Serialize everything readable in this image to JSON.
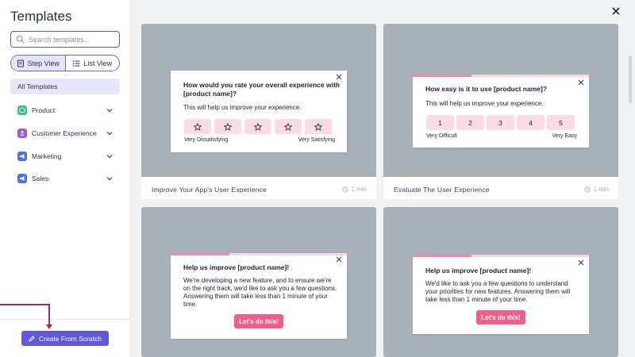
{
  "sidebar": {
    "title": "Templates",
    "search_placeholder": "Search templates..",
    "view_toggle": {
      "step_view": "Step View",
      "list_view": "List View"
    },
    "all_templates": "All Templates",
    "categories": [
      {
        "label": "Product",
        "icon": "cube-icon",
        "color": "#3dbf7f"
      },
      {
        "label": "Customer Experience",
        "icon": "users-icon",
        "color": "#a458d4"
      },
      {
        "label": "Marketing",
        "icon": "megaphone-icon",
        "color": "#4f72e3"
      },
      {
        "label": "Sales",
        "icon": "megaphone-icon",
        "color": "#4f72e3"
      }
    ],
    "create_button": "Create From Scratch"
  },
  "templates": [
    {
      "title": "Improve Your App's User Experience",
      "time": "1 min",
      "question": "How would you rate your overall experience with [product name]?",
      "subtitle": "This will help us improve your experience.",
      "scale_low": "Very Dissatisfying",
      "scale_high": "Very Satisfying"
    },
    {
      "title": "Evaluate The User Experience",
      "time": "1 min",
      "question": "How easy is it to use [product name]?",
      "subtitle": "This will help us improve your experience.",
      "options": [
        "1",
        "2",
        "3",
        "4",
        "5"
      ],
      "scale_low": "Very Difficult",
      "scale_high": "Very Easy"
    },
    {
      "title": "Help us improve [product name]!",
      "body": "We're developing a new feature, and to ensure we're on the right track, we'd like to ask you a few questions. Answering them will take less than 1 minute of your time.",
      "cta": "Let's do this!"
    },
    {
      "title": "Help us improve [product name]!",
      "body": "We'd like to ask you a few questions to understand your priorities for new features. Answering them will take less than 1 minute of your time.",
      "cta": "Let's do this!"
    }
  ],
  "colors": {
    "accent": "#6158d8",
    "pink": "#ef5f8a",
    "preview_bg": "#a8b0b8"
  }
}
